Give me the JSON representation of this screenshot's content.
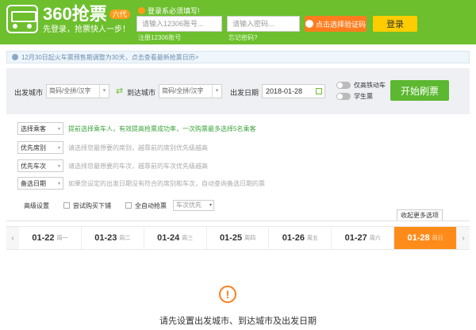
{
  "header": {
    "logo_title": "360抢票",
    "logo_badge": "六代",
    "slogan": "先登录，抢票快人一步！",
    "login_hint": "登录系必须填写!",
    "account_placeholder": "请输入12306账号...",
    "password_placeholder": "请输入密码...",
    "register_link": "注册12306账号",
    "forgot_link": "忘记密码?",
    "captcha_button": "点击选择验证码",
    "login_button": "登录"
  },
  "notice": {
    "text": "12月30日起火车票预售期调整为30天，点击查看最新抢票日历>"
  },
  "search": {
    "from_label": "出发城市",
    "from_placeholder": "简码/全拼/汉字",
    "to_label": "到达城市",
    "to_placeholder": "简码/全拼/汉字",
    "date_label": "出发日期",
    "date_value": "2018-01-28",
    "toggle_gd": "仅高铁动车",
    "toggle_student": "学生票",
    "start_button": "开始刷票"
  },
  "options": [
    {
      "button": "选择乘客",
      "text": "提前选择乘车人，有效提高抢票成功率，一次购票最多选择5名乘客",
      "highlight": true
    },
    {
      "button": "优先席别",
      "text": "请选择您最想要的席别，越靠前的席别优先级越高",
      "highlight": false
    },
    {
      "button": "优先车次",
      "text": "请选择您最想要的车次，越靠前的车次优先级越高",
      "highlight": false
    },
    {
      "button": "备选日期",
      "text": "如果您设定的出发日期没有符合的席别和车次，自动查询备选日期的票",
      "highlight": false
    }
  ],
  "advanced": {
    "label": "高级设置",
    "try_lower": "尝试购买下铺",
    "auto_grab": "全自动抢票",
    "priority_value": "车次优先",
    "more_options": "收起更多选项"
  },
  "date_strip": [
    {
      "date": "01-22",
      "weekday": "周一"
    },
    {
      "date": "01-23",
      "weekday": "周二"
    },
    {
      "date": "01-24",
      "weekday": "周三"
    },
    {
      "date": "01-25",
      "weekday": "周四"
    },
    {
      "date": "01-26",
      "weekday": "周五"
    },
    {
      "date": "01-27",
      "weekday": "周六"
    },
    {
      "date": "01-28",
      "weekday": "周日",
      "active": true
    }
  ],
  "empty_message": "请先设置出发城市、到达城市及出发日期",
  "colors": {
    "brand": "#6dbf2e",
    "accent": "#ff8c1a",
    "login": "#ffcc00"
  }
}
